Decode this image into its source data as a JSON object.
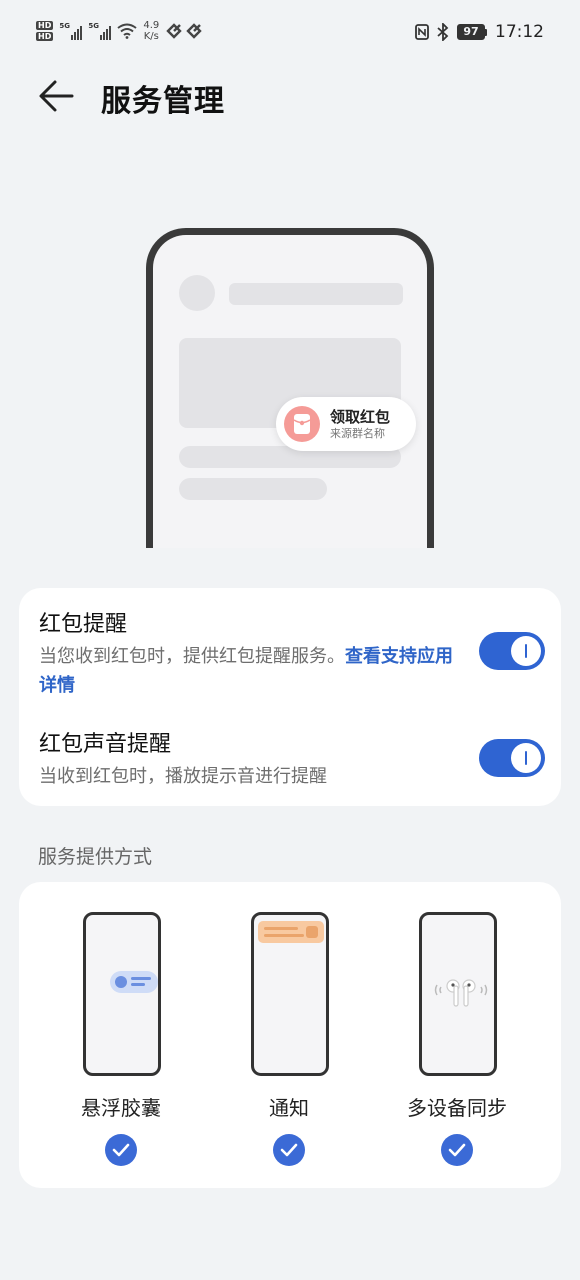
{
  "status_bar": {
    "hd1": "HD",
    "hd2": "HD",
    "net1": "5G",
    "net2": "5G",
    "speed_value": "4.9",
    "speed_unit": "K/s",
    "battery": "97",
    "time": "17:12"
  },
  "header": {
    "title": "服务管理"
  },
  "illustration": {
    "capsule_title": "领取红包",
    "capsule_subtitle": "来源群名称"
  },
  "settings": {
    "items": [
      {
        "title": "红包提醒",
        "desc_text": "当您收到红包时，提供红包提醒服务。",
        "desc_link": "查看支持应用详情",
        "enabled": true
      },
      {
        "title": "红包声音提醒",
        "desc_text": "当收到红包时，播放提示音进行提醒",
        "enabled": true
      }
    ]
  },
  "service_section": {
    "label": "服务提供方式",
    "options": [
      {
        "label": "悬浮胶囊",
        "checked": true
      },
      {
        "label": "通知",
        "checked": true
      },
      {
        "label": "多设备同步",
        "checked": true
      }
    ]
  },
  "colors": {
    "accent": "#2f64d2",
    "link": "#2f65c8",
    "red_packet": "#f59b97",
    "background": "#f1f3f5"
  }
}
